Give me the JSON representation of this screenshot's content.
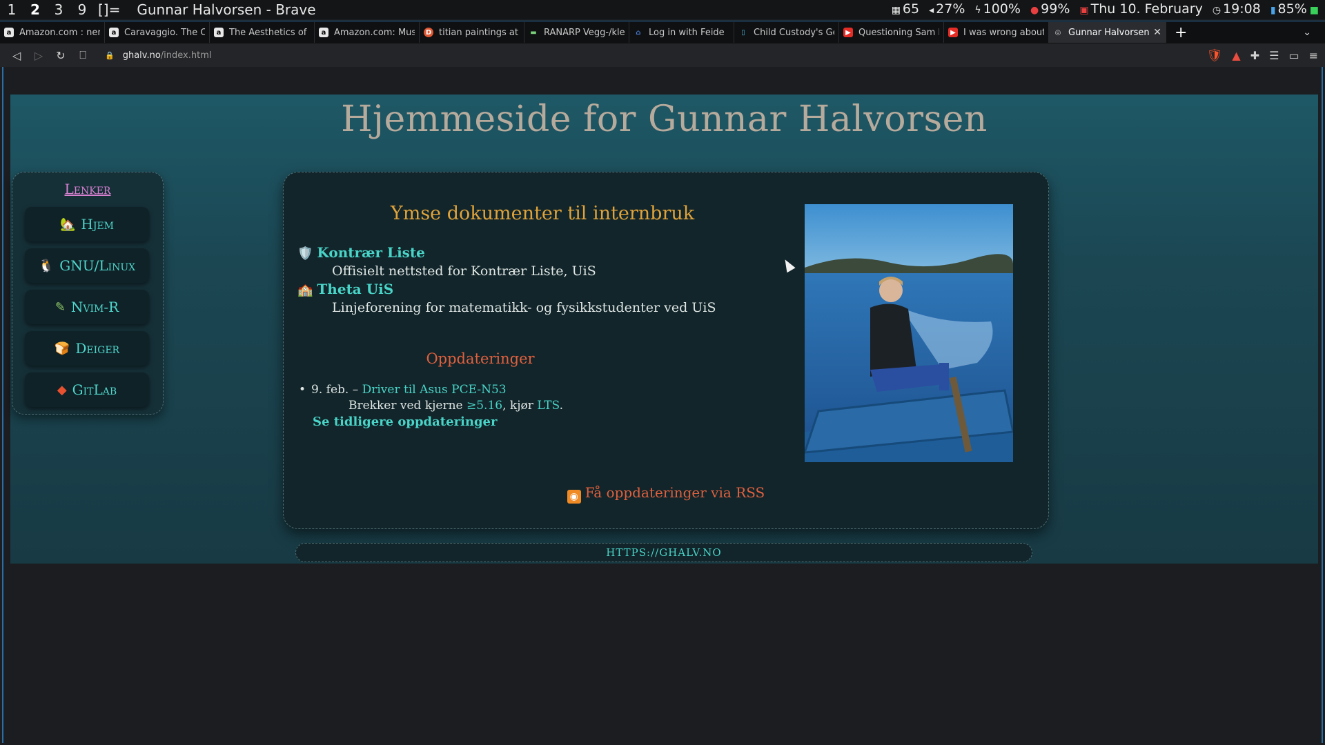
{
  "wm": {
    "workspaces": [
      "1",
      "2",
      "3",
      "9"
    ],
    "layout": "[]=",
    "window_title": "Gunnar Halvorsen - Brave",
    "status": {
      "mem": "65",
      "volume": "27%",
      "charge": "100%",
      "cpu": "99%",
      "date": "Thu 10. February",
      "time": "19:08",
      "battery": "85%"
    }
  },
  "tabs": [
    {
      "title": "Amazon.com : nerdrum",
      "fav": "a"
    },
    {
      "title": "Caravaggio. The Compl",
      "fav": "a"
    },
    {
      "title": "The Aesthetics of Music",
      "fav": "a"
    },
    {
      "title": "Amazon.com: Music as",
      "fav": "a"
    },
    {
      "title": "titian paintings at Duck",
      "fav": "D"
    },
    {
      "title": "RANARP Vegg-/klemme",
      "fav": "▬"
    },
    {
      "title": "Log in with Feide",
      "fav": "⌂"
    },
    {
      "title": "Child Custody's Gende",
      "fav": "▯"
    },
    {
      "title": "Questioning Sam Harris",
      "fav": "▶"
    },
    {
      "title": "I was wrong about Appl",
      "fav": "▶"
    },
    {
      "title": "Gunnar Halvorsen",
      "fav": "◎"
    }
  ],
  "nav": {
    "url_host": "ghalv.no",
    "url_path": "/index.html"
  },
  "site": {
    "title": "Hjemmeside for Gunnar Halvorsen",
    "sidebar_title": "Lenker",
    "sidebar_items": [
      {
        "label": "Hjem",
        "icon": "🏡"
      },
      {
        "label": "GNU/Linux",
        "icon": "🐧"
      },
      {
        "label": "Nvim-R",
        "icon": "✎"
      },
      {
        "label": "Deiger",
        "icon": "🍞"
      },
      {
        "label": "GitLab",
        "icon": "◆"
      }
    ],
    "docs_heading": "Ymse dokumenter til internbruk",
    "docs": [
      {
        "label": "Kontrær Liste",
        "icon": "🛡️",
        "desc": "Offisielt nettsted for Kontrær Liste, UiS"
      },
      {
        "label": "Theta UiS",
        "icon": "🏫",
        "desc": "Linjeforening for matematikk- og fysikkstudenter ved UiS"
      }
    ],
    "updates_heading": "Oppdateringer",
    "update": {
      "date": "9. feb. –",
      "link": "Driver til Asus PCE-N53",
      "detail_pre": "Brekker ved kjerne ",
      "detail_version": "≥5.16",
      "detail_mid": ", kjør ",
      "detail_lts": "LTS",
      "detail_end": "."
    },
    "older_link": "Se tidligere oppdateringer",
    "rss_label": "Få oppdateringer via RSS",
    "footer": "HTTPS://GHALV.NO"
  }
}
